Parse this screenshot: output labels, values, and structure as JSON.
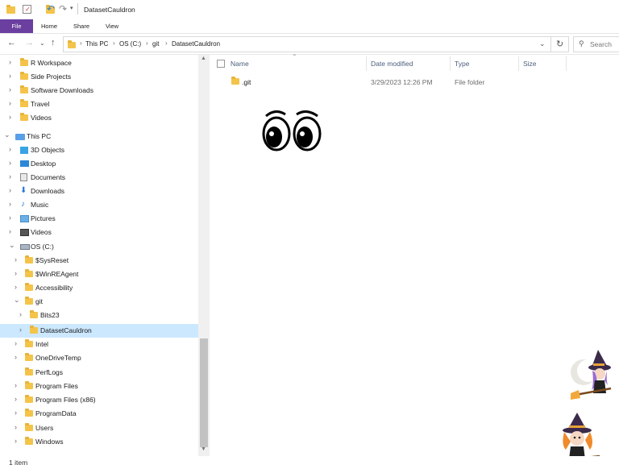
{
  "window": {
    "title": "DatasetCauldron"
  },
  "ribbon": {
    "tabs": [
      {
        "label": "File"
      },
      {
        "label": "Home"
      },
      {
        "label": "Share"
      },
      {
        "label": "View"
      }
    ]
  },
  "address": {
    "crumbs": [
      "This PC",
      "OS (C:)",
      "git",
      "DatasetCauldron"
    ],
    "search_placeholder": "Search"
  },
  "sidebar": {
    "items": [
      {
        "label": "R Workspace",
        "icon": "folder-icon"
      },
      {
        "label": "Side Projects",
        "icon": "folder-icon"
      },
      {
        "label": "Software Downloads",
        "icon": "folder-icon"
      },
      {
        "label": "Travel",
        "icon": "folder-icon"
      },
      {
        "label": "Videos",
        "icon": "folder-icon"
      },
      {
        "label": "This PC",
        "icon": "computer-icon"
      },
      {
        "label": "3D Objects",
        "icon": "3d-objects-icon"
      },
      {
        "label": "Desktop",
        "icon": "desktop-icon"
      },
      {
        "label": "Documents",
        "icon": "documents-icon"
      },
      {
        "label": "Downloads",
        "icon": "downloads-icon"
      },
      {
        "label": "Music",
        "icon": "music-icon"
      },
      {
        "label": "Pictures",
        "icon": "pictures-icon"
      },
      {
        "label": "Videos",
        "icon": "videos-icon"
      },
      {
        "label": "OS (C:)",
        "icon": "drive-icon"
      },
      {
        "label": "$SysReset",
        "icon": "folder-icon"
      },
      {
        "label": "$WinREAgent",
        "icon": "folder-icon"
      },
      {
        "label": "Accessibility",
        "icon": "folder-icon"
      },
      {
        "label": "git",
        "icon": "folder-icon"
      },
      {
        "label": "Bits23",
        "icon": "folder-icon"
      },
      {
        "label": "DatasetCauldron",
        "icon": "folder-icon"
      },
      {
        "label": "Intel",
        "icon": "folder-icon"
      },
      {
        "label": "OneDriveTemp",
        "icon": "folder-icon"
      },
      {
        "label": "PerfLogs",
        "icon": "folder-icon"
      },
      {
        "label": "Program Files",
        "icon": "folder-icon"
      },
      {
        "label": "Program Files (x86)",
        "icon": "folder-icon"
      },
      {
        "label": "ProgramData",
        "icon": "folder-icon"
      },
      {
        "label": "Users",
        "icon": "folder-icon"
      },
      {
        "label": "Windows",
        "icon": "folder-icon"
      }
    ]
  },
  "columns": {
    "name": "Name",
    "date_modified": "Date modified",
    "type": "Type",
    "size": "Size"
  },
  "files": [
    {
      "name": ".git",
      "date_modified": "3/29/2023 12:26 PM",
      "type": "File folder",
      "size": ""
    }
  ],
  "status": {
    "item_count": "1 item"
  },
  "colors": {
    "file_tab": "#6a3fa0",
    "selection": "#cce8ff",
    "folder": "#f4c44a",
    "witch_hat": "#3b2a4a",
    "witch_hair_purple": "#9b6bd3",
    "witch_hair_orange": "#f08a2a"
  }
}
